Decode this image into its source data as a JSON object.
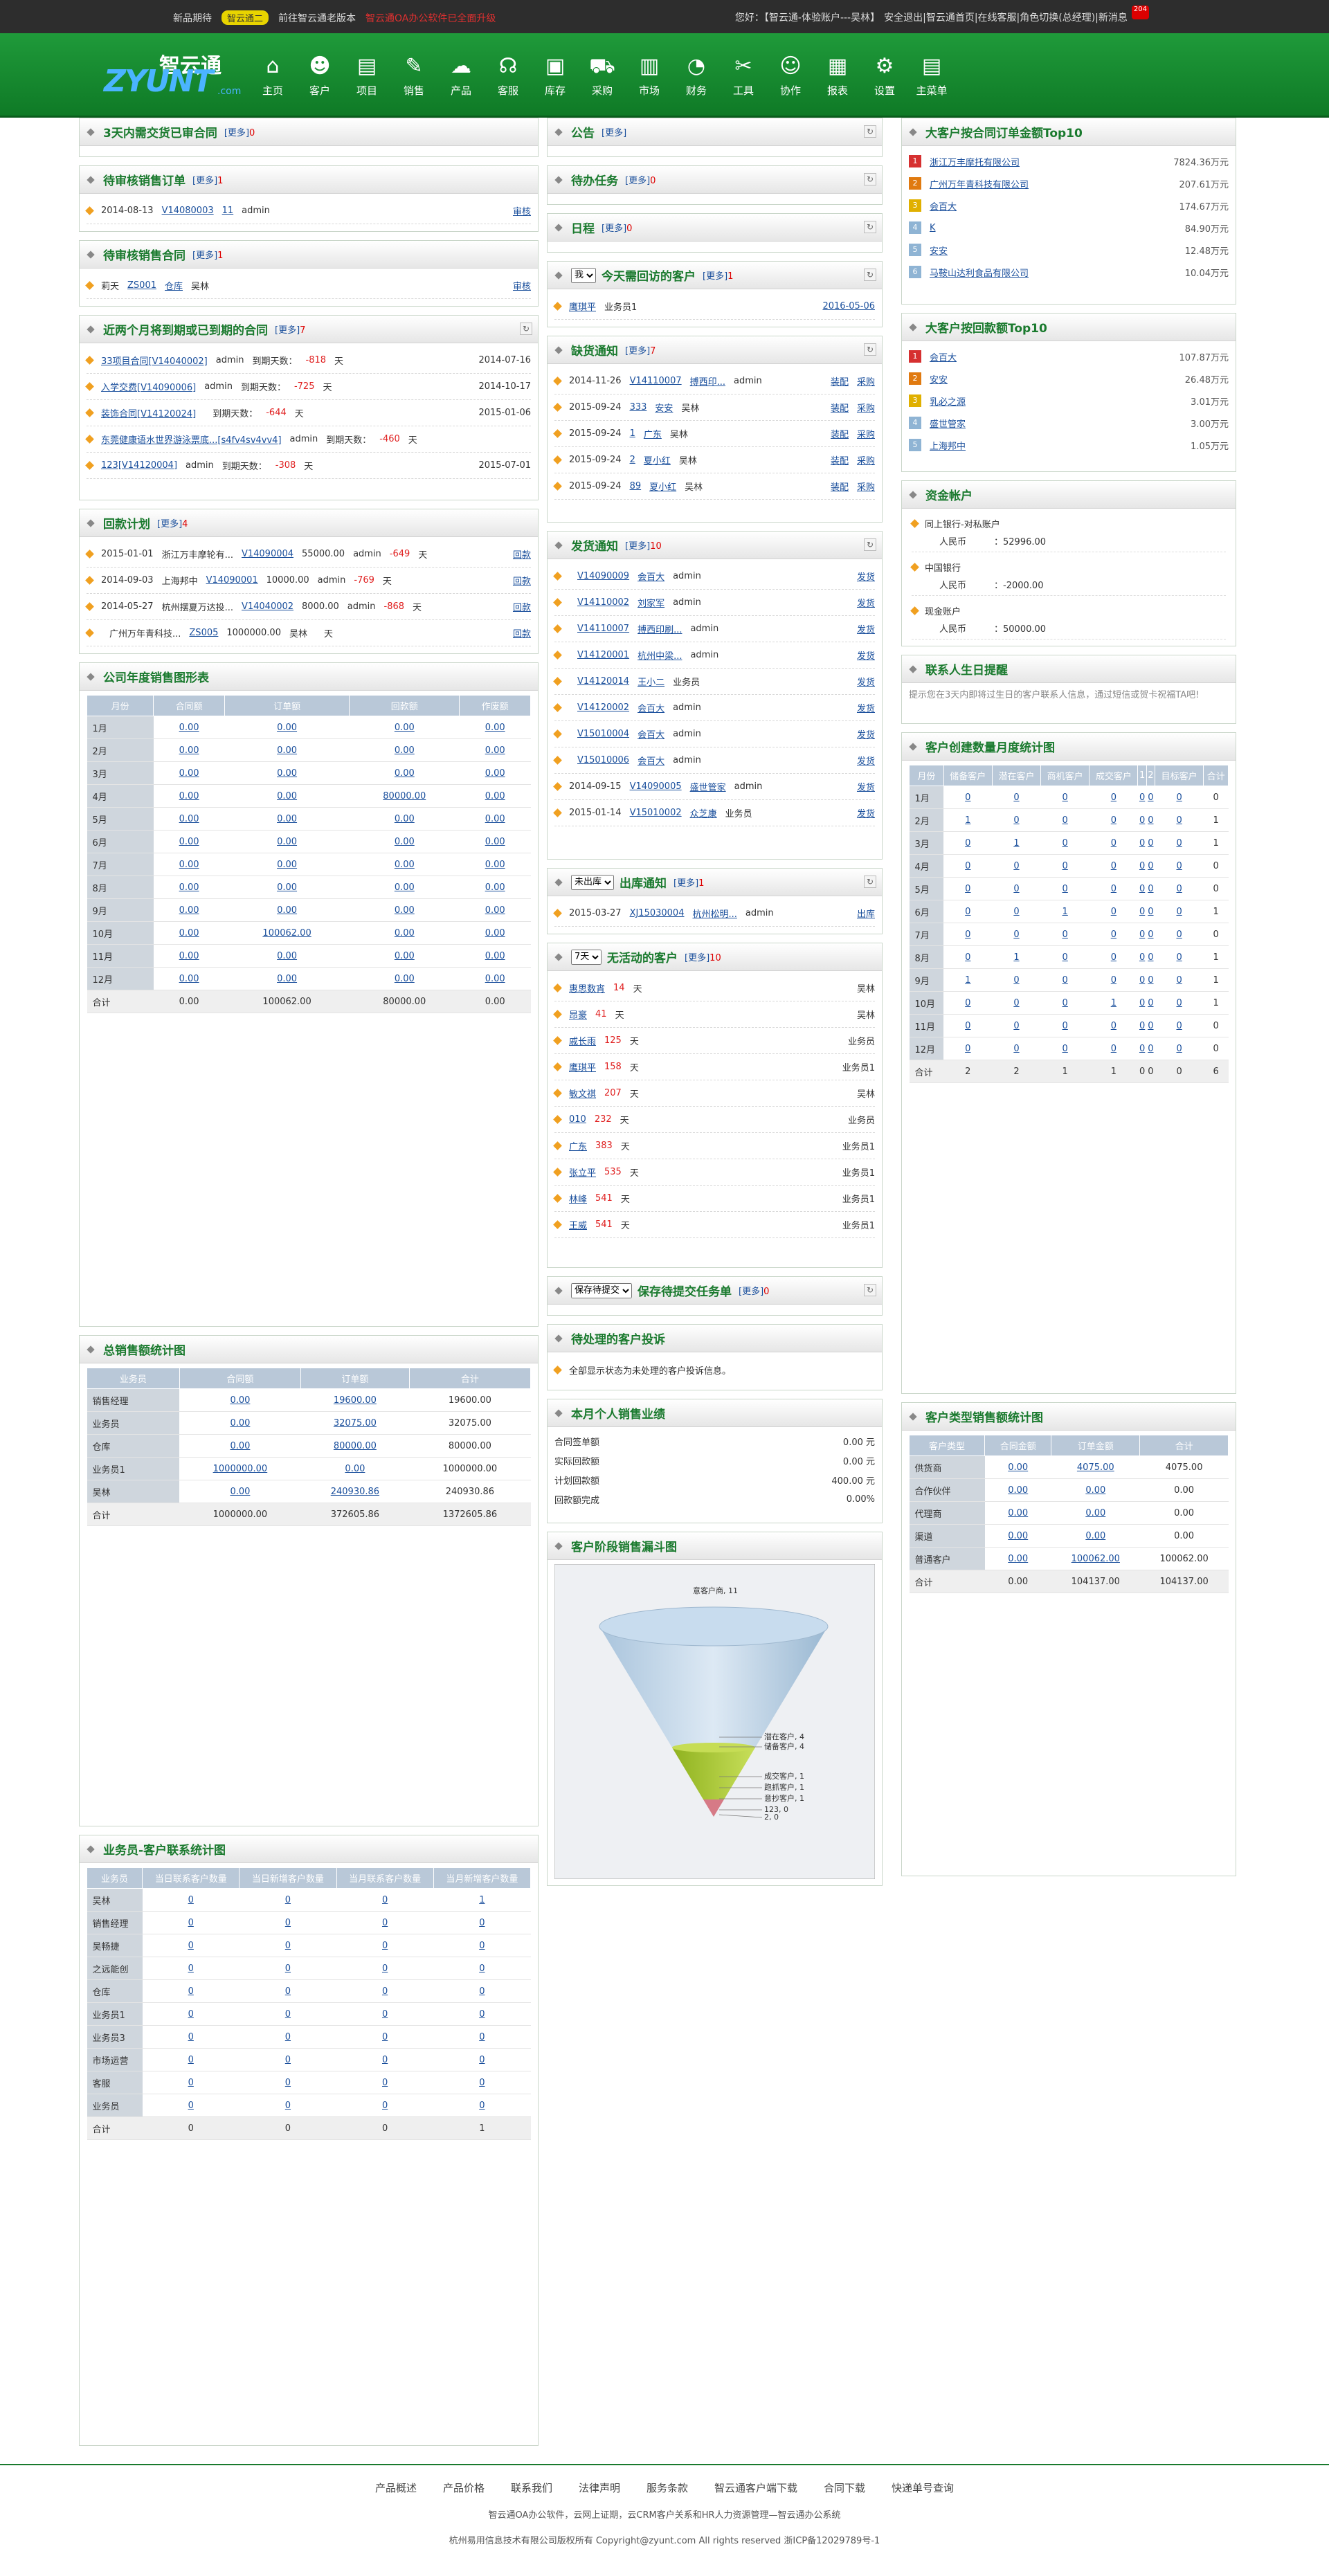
{
  "topbar": {
    "edition_prefix": "新品期待",
    "edition_badge": "智云通二",
    "go_old": "前往智云通老版本",
    "notice": "智云通OA办公软件已全面升级",
    "greeting": "您好：【智云通-体验账户---吴林】",
    "links": "安全退出|智云通首页|在线客服|角色切换(总经理)|新消息",
    "msg_count": "204"
  },
  "logo": {
    "cn": "智云通",
    "en": "ZYUNT",
    ".com": ".com"
  },
  "nav": [
    {
      "icon": "⌂",
      "label": "主页"
    },
    {
      "icon": "☻",
      "label": "客户"
    },
    {
      "icon": "▤",
      "label": "项目"
    },
    {
      "icon": "✎",
      "label": "销售"
    },
    {
      "icon": "☁",
      "label": "产品"
    },
    {
      "icon": "☊",
      "label": "客服"
    },
    {
      "icon": "▣",
      "label": "库存"
    },
    {
      "icon": "⛟",
      "label": "采购"
    },
    {
      "icon": "▥",
      "label": "市场"
    },
    {
      "icon": "◔",
      "label": "财务"
    },
    {
      "icon": "✂",
      "label": "工具"
    },
    {
      "icon": "☺",
      "label": "协作"
    },
    {
      "icon": "▦",
      "label": "报表"
    },
    {
      "icon": "⚙",
      "label": "设置"
    },
    {
      "icon": "▤",
      "label": "主菜单"
    }
  ],
  "c1": {
    "p1": {
      "title": "3天内需交货已审合同",
      "more": "更多",
      "count": "0"
    },
    "p2": {
      "title": "待审核销售订单",
      "more": "更多",
      "count": "1",
      "rows": [
        {
          "date": "2014-08-13",
          "no": "V14080003",
          "qty": "11",
          "user": "admin",
          "act": "审核"
        }
      ]
    },
    "p3": {
      "title": "待审核销售合同",
      "more": "更多",
      "count": "1",
      "rows": [
        {
          "a": "莉天",
          "b": "ZS001",
          "c": "仓库",
          "d": "吴林",
          "act": "审核"
        }
      ]
    },
    "p4": {
      "title": "近两个月将到期或已到期的合同",
      "more": "更多",
      "count": "7",
      "rows": [
        {
          "name": "33项目合同[V14040002]",
          "user": "admin",
          "lbl": "到期天数：",
          "days": "-818",
          "unit": "天",
          "date": "2014-07-16"
        },
        {
          "name": "入学交费[V14090006]",
          "user": "admin",
          "lbl": "到期天数：",
          "days": "-725",
          "unit": "天",
          "date": "2014-10-17"
        },
        {
          "name": "装饰合同[V14120024]",
          "user": "",
          "lbl": "到期天数：",
          "days": "-644",
          "unit": "天",
          "date": "2015-01-06"
        },
        {
          "name": "东莞健康语水世界游泳票底...[s4fv4sv4vv4]",
          "user": "admin",
          "lbl": "到期天数：",
          "days": "-460",
          "unit": "天",
          "date": ""
        },
        {
          "name": "123[V14120004]",
          "user": "admin",
          "lbl": "到期天数：",
          "days": "-308",
          "unit": "天",
          "date": "2015-07-01"
        }
      ]
    },
    "p5": {
      "title": "回款计划",
      "more": "更多",
      "count": "4",
      "rows": [
        {
          "date": "2015-01-01",
          "cust": "浙江万丰摩轮有...",
          "no": "V14090004",
          "amt": "55000.00",
          "user": "admin",
          "days": "-649",
          "unit": "天",
          "act": "回款"
        },
        {
          "date": "2014-09-03",
          "cust": "上海邦中",
          "no": "V14090001",
          "amt": "10000.00",
          "user": "admin",
          "days": "-769",
          "unit": "天",
          "act": "回款"
        },
        {
          "date": "2014-05-27",
          "cust": "杭州摆夏万达投...",
          "no": "V14040002",
          "amt": "8000.00",
          "user": "admin",
          "days": "-868",
          "unit": "天",
          "act": "回款"
        },
        {
          "date": "",
          "cust": "广州万年青科技...",
          "no": "ZS005",
          "amt": "1000000.00",
          "user": "吴林",
          "days": "",
          "unit": "天",
          "act": "回款"
        }
      ]
    },
    "p6": {
      "title": "公司年度销售图形表",
      "headers": [
        "月份",
        "合同额",
        "订单额",
        "回款额",
        "作废额"
      ],
      "rows": [
        [
          "1月",
          "0.00",
          "0.00",
          "0.00",
          "0.00"
        ],
        [
          "2月",
          "0.00",
          "0.00",
          "0.00",
          "0.00"
        ],
        [
          "3月",
          "0.00",
          "0.00",
          "0.00",
          "0.00"
        ],
        [
          "4月",
          "0.00",
          "0.00",
          "80000.00",
          "0.00"
        ],
        [
          "5月",
          "0.00",
          "0.00",
          "0.00",
          "0.00"
        ],
        [
          "6月",
          "0.00",
          "0.00",
          "0.00",
          "0.00"
        ],
        [
          "7月",
          "0.00",
          "0.00",
          "0.00",
          "0.00"
        ],
        [
          "8月",
          "0.00",
          "0.00",
          "0.00",
          "0.00"
        ],
        [
          "9月",
          "0.00",
          "0.00",
          "0.00",
          "0.00"
        ],
        [
          "10月",
          "0.00",
          "100062.00",
          "0.00",
          "0.00"
        ],
        [
          "11月",
          "0.00",
          "0.00",
          "0.00",
          "0.00"
        ],
        [
          "12月",
          "0.00",
          "0.00",
          "0.00",
          "0.00"
        ],
        [
          "合计",
          "0.00",
          "100062.00",
          "80000.00",
          "0.00"
        ]
      ]
    },
    "p7": {
      "title": "总销售额统计图",
      "headers": [
        "业务员",
        "合同额",
        "订单额",
        "合计"
      ],
      "rows": [
        [
          "销售经理",
          "0.00",
          "19600.00",
          "19600.00"
        ],
        [
          "业务员",
          "0.00",
          "32075.00",
          "32075.00"
        ],
        [
          "仓库",
          "0.00",
          "80000.00",
          "80000.00"
        ],
        [
          "业务员1",
          "1000000.00",
          "0.00",
          "1000000.00"
        ],
        [
          "吴林",
          "0.00",
          "240930.86",
          "240930.86"
        ],
        [
          "合计",
          "1000000.00",
          "372605.86",
          "1372605.86"
        ]
      ]
    },
    "p8": {
      "title": "业务员-客户联系统计图",
      "headers": [
        "业务员",
        "当日联系客户数量",
        "当日新增客户数量",
        "当月联系客户数量",
        "当月新增客户数量"
      ],
      "rows": [
        [
          "吴林",
          "0",
          "0",
          "0",
          "1"
        ],
        [
          "销售经理",
          "0",
          "0",
          "0",
          "0"
        ],
        [
          "吴畅捷",
          "0",
          "0",
          "0",
          "0"
        ],
        [
          "之远能创",
          "0",
          "0",
          "0",
          "0"
        ],
        [
          "仓库",
          "0",
          "0",
          "0",
          "0"
        ],
        [
          "业务员1",
          "0",
          "0",
          "0",
          "0"
        ],
        [
          "业务员3",
          "0",
          "0",
          "0",
          "0"
        ],
        [
          "市场运营",
          "0",
          "0",
          "0",
          "0"
        ],
        [
          "客服",
          "0",
          "0",
          "0",
          "0"
        ],
        [
          "业务员",
          "0",
          "0",
          "0",
          "0"
        ],
        [
          "合计",
          "0",
          "0",
          "0",
          "1"
        ]
      ]
    }
  },
  "c2": {
    "p1": {
      "title": "公告",
      "more": "更多"
    },
    "p2": {
      "title": "待办任务",
      "more": "更多",
      "count": "0"
    },
    "p3": {
      "title": "日程",
      "more": "更多",
      "count": "0"
    },
    "p4": {
      "select": "我",
      "title": "今天需回访的客户",
      "more": "更多",
      "count": "1",
      "rows": [
        {
          "name": "鹰琪平",
          "user": "业务员1",
          "date": "2016-05-06"
        }
      ]
    },
    "p5": {
      "title": "缺货通知",
      "more": "更多",
      "count": "7",
      "rows": [
        {
          "date": "2014-11-26",
          "no": "V14110007",
          "p": "搏西印...",
          "u": "admin",
          "a1": "装配",
          "a2": "采购"
        },
        {
          "date": "2015-09-24",
          "no": "333",
          "p": "安安",
          "u": "吴林",
          "a1": "装配",
          "a2": "采购"
        },
        {
          "date": "2015-09-24",
          "no": "1",
          "p": "广东",
          "u": "吴林",
          "a1": "装配",
          "a2": "采购"
        },
        {
          "date": "2015-09-24",
          "no": "2",
          "p": "夏小红",
          "u": "吴林",
          "a1": "装配",
          "a2": "采购"
        },
        {
          "date": "2015-09-24",
          "no": "89",
          "p": "夏小红",
          "u": "吴林",
          "a1": "装配",
          "a2": "采购"
        }
      ]
    },
    "p6": {
      "title": "发货通知",
      "more": "更多",
      "count": "10",
      "rows": [
        {
          "d": "",
          "no": "V14090009",
          "c": "会百大",
          "u": "admin",
          "a": "发货"
        },
        {
          "d": "",
          "no": "V14110002",
          "c": "刘家军",
          "u": "admin",
          "a": "发货"
        },
        {
          "d": "",
          "no": "V14110007",
          "c": "搏西印刷...",
          "u": "admin",
          "a": "发货"
        },
        {
          "d": "",
          "no": "V14120001",
          "c": "杭州中梁...",
          "u": "admin",
          "a": "发货"
        },
        {
          "d": "",
          "no": "V14120014",
          "c": "王小二",
          "u": "业务员",
          "a": "发货"
        },
        {
          "d": "",
          "no": "V14120002",
          "c": "会百大",
          "u": "admin",
          "a": "发货"
        },
        {
          "d": "",
          "no": "V15010004",
          "c": "会百大",
          "u": "admin",
          "a": "发货"
        },
        {
          "d": "",
          "no": "V15010006",
          "c": "会百大",
          "u": "admin",
          "a": "发货"
        },
        {
          "d": "2014-09-15",
          "no": "V14090005",
          "c": "盛世管家",
          "u": "admin",
          "a": "发货"
        },
        {
          "d": "2015-01-14",
          "no": "V15010002",
          "c": "众芝康",
          "u": "业务员",
          "a": "发货"
        }
      ]
    },
    "p7": {
      "select": "未出库",
      "title": "出库通知",
      "more": "更多",
      "count": "1",
      "rows": [
        {
          "d": "2015-03-27",
          "no": "XJ15030004",
          "c": "杭州松明...",
          "u": "admin",
          "a": "出库"
        }
      ]
    },
    "p8": {
      "select": "7天",
      "title": "无活动的客户",
      "more": "更多",
      "count": "10",
      "rows": [
        {
          "n": "惠思数宵",
          "d": "14",
          "u": "吴林"
        },
        {
          "n": "昂豪",
          "d": "41",
          "u": "吴林"
        },
        {
          "n": "戚长雨",
          "d": "125",
          "u": "业务员"
        },
        {
          "n": "鹰琪平",
          "d": "158",
          "u": "业务员1"
        },
        {
          "n": "敏文祺",
          "d": "207",
          "u": "吴林"
        },
        {
          "n": "010",
          "d": "232",
          "u": "业务员"
        },
        {
          "n": "广东",
          "d": "383",
          "u": "业务员1"
        },
        {
          "n": "张立平",
          "d": "535",
          "u": "业务员1"
        },
        {
          "n": "林峰",
          "d": "541",
          "u": "业务员1"
        },
        {
          "n": "王威",
          "d": "541",
          "u": "业务员1"
        }
      ],
      "unit": "天"
    },
    "p9": {
      "select": "保存待提交",
      "title": "保存待提交任务单",
      "more": "更多",
      "count": "0"
    },
    "p10": {
      "title": "待处理的客户投诉",
      "text": "全部显示状态为未处理的客户投诉信息。"
    },
    "p11": {
      "title": "本月个人销售业绩",
      "rows": [
        {
          "k": "合同签单额",
          "v": "0.00 元"
        },
        {
          "k": "实际回款额",
          "v": "0.00 元"
        },
        {
          "k": "计划回款额",
          "v": "400.00 元"
        },
        {
          "k": "回款额完成",
          "v": "0.00%"
        }
      ]
    },
    "p12": {
      "title": "客户阶段销售漏斗图"
    }
  },
  "chart_data": {
    "type": "funnel",
    "series": [
      {
        "values": [
          {
            "label": "意客户商",
            "value": 11
          },
          {
            "label": "潜在客户",
            "value": 4
          },
          {
            "label": "储备客户",
            "value": 4
          },
          {
            "label": "成交客户",
            "value": 1
          },
          {
            "label": "跑抓客户",
            "value": 1
          },
          {
            "label": "意抄客户",
            "value": 1
          },
          {
            "label": "123",
            "value": 0
          },
          {
            "label": "2",
            "value": 0
          }
        ]
      }
    ]
  },
  "c3": {
    "p1": {
      "title": "大客户按合同订单金额Top10",
      "rows": [
        {
          "n": "浙江万丰摩托有限公司",
          "v": "7824.36万元",
          "c": "#d63030"
        },
        {
          "n": "广州万年青科技有限公司",
          "v": "207.61万元",
          "c": "#e07a10"
        },
        {
          "n": "会百大",
          "v": "174.67万元",
          "c": "#e0b000"
        },
        {
          "n": "K",
          "v": "84.90万元",
          "c": "#8fb4d4"
        },
        {
          "n": "安安",
          "v": "12.48万元",
          "c": "#8fb4d4"
        },
        {
          "n": "马鞍山达利食品有限公司",
          "v": "10.04万元",
          "c": "#8fb4d4"
        }
      ]
    },
    "p2": {
      "title": "大客户按回款额Top10",
      "rows": [
        {
          "n": "会百大",
          "v": "107.87万元",
          "c": "#d63030"
        },
        {
          "n": "安安",
          "v": "26.48万元",
          "c": "#e07a10"
        },
        {
          "n": "乳必之源",
          "v": "3.01万元",
          "c": "#e0b000"
        },
        {
          "n": "盛世管家",
          "v": "3.00万元",
          "c": "#8fb4d4"
        },
        {
          "n": "上海邦中",
          "v": "1.05万元",
          "c": "#8fb4d4"
        }
      ]
    },
    "p3": {
      "title": "资金帐户",
      "accounts": [
        {
          "name": "同上银行-对私账户",
          "cur": "人民币",
          "amt": "：52996.00"
        },
        {
          "name": "中国银行",
          "cur": "人民币",
          "amt": "：-2000.00"
        },
        {
          "name": "现金账户",
          "cur": "人民币",
          "amt": "：50000.00"
        }
      ]
    },
    "p4": {
      "title": "联系人生日提醒",
      "text": "提示您在3天内即将过生日的客户联系人信息，通过短信或贺卡祝福TA吧!"
    },
    "p5": {
      "title": "客户创建数量月度统计图",
      "headers": [
        "月份",
        "储备客户",
        "潜在客户",
        "商机客户",
        "成交客户",
        "1",
        "2",
        "目标客户",
        "合计"
      ],
      "rows": [
        [
          "1月",
          "0",
          "0",
          "0",
          "0",
          "0",
          "0",
          "0",
          "0"
        ],
        [
          "2月",
          "1",
          "0",
          "0",
          "0",
          "0",
          "0",
          "0",
          "1"
        ],
        [
          "3月",
          "0",
          "1",
          "0",
          "0",
          "0",
          "0",
          "0",
          "1"
        ],
        [
          "4月",
          "0",
          "0",
          "0",
          "0",
          "0",
          "0",
          "0",
          "0"
        ],
        [
          "5月",
          "0",
          "0",
          "0",
          "0",
          "0",
          "0",
          "0",
          "0"
        ],
        [
          "6月",
          "0",
          "0",
          "1",
          "0",
          "0",
          "0",
          "0",
          "1"
        ],
        [
          "7月",
          "0",
          "0",
          "0",
          "0",
          "0",
          "0",
          "0",
          "0"
        ],
        [
          "8月",
          "0",
          "1",
          "0",
          "0",
          "0",
          "0",
          "0",
          "1"
        ],
        [
          "9月",
          "1",
          "0",
          "0",
          "0",
          "0",
          "0",
          "0",
          "1"
        ],
        [
          "10月",
          "0",
          "0",
          "0",
          "1",
          "0",
          "0",
          "0",
          "1"
        ],
        [
          "11月",
          "0",
          "0",
          "0",
          "0",
          "0",
          "0",
          "0",
          "0"
        ],
        [
          "12月",
          "0",
          "0",
          "0",
          "0",
          "0",
          "0",
          "0",
          "0"
        ],
        [
          "合计",
          "2",
          "2",
          "1",
          "1",
          "0",
          "0",
          "0",
          "6"
        ]
      ]
    },
    "p6": {
      "title": "客户类型销售额统计图",
      "headers": [
        "客户类型",
        "合同金额",
        "订单金额",
        "合计"
      ],
      "rows": [
        [
          "供货商",
          "0.00",
          "4075.00",
          "4075.00"
        ],
        [
          "合作伙伴",
          "0.00",
          "0.00",
          "0.00"
        ],
        [
          "代理商",
          "0.00",
          "0.00",
          "0.00"
        ],
        [
          "渠道",
          "0.00",
          "0.00",
          "0.00"
        ],
        [
          "普通客户",
          "0.00",
          "100062.00",
          "100062.00"
        ],
        [
          "合计",
          "0.00",
          "104137.00",
          "104137.00"
        ]
      ]
    }
  },
  "footer": {
    "links": [
      "产品概述",
      "产品价格",
      "联系我们",
      "法律声明",
      "服务条款",
      "智云通客户端下载",
      "合同下载",
      "快递单号查询"
    ],
    "line1": "智云通OA办公软件，云网上证期，云CRM客户关系和HR人力资源管理—智云通办公系统",
    "line2": "杭州易用信息技术有限公司版权所有 Copyright@zyunt.com All rights reserved 浙ICP备12029789号-1"
  }
}
